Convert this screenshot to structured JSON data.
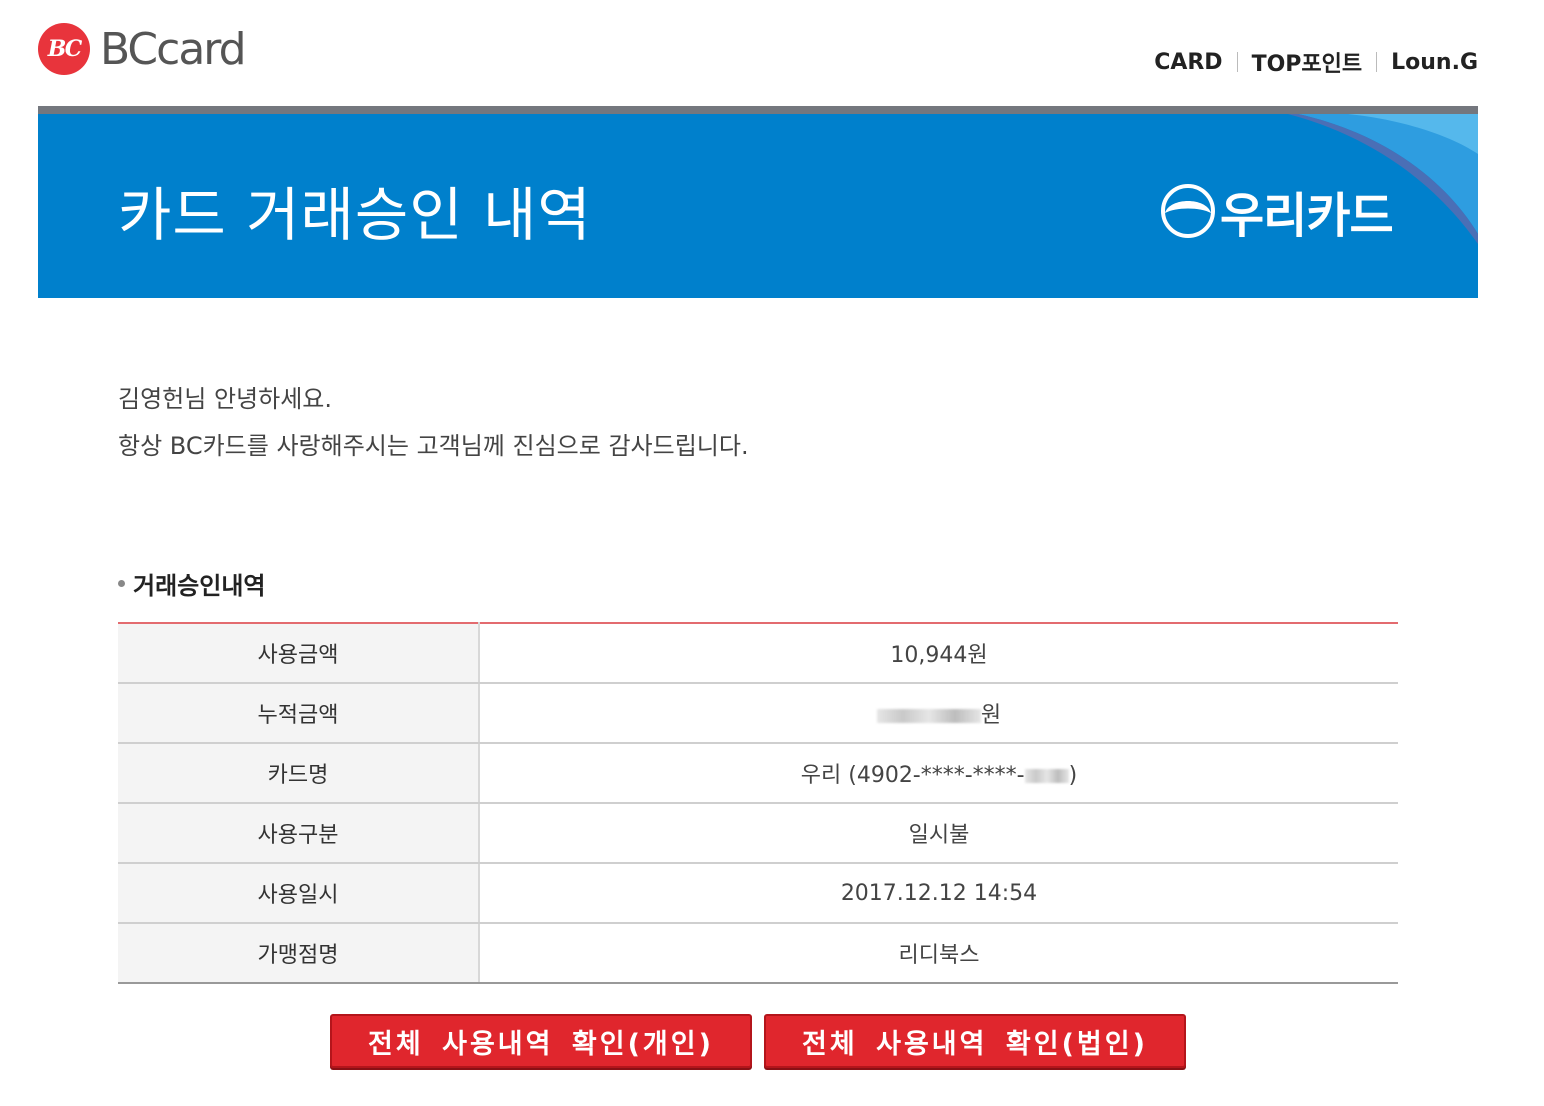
{
  "header": {
    "logo_mark": "BC",
    "logo_text": "BCcard",
    "nav": [
      "CARD",
      "TOP포인트",
      "Loun.G"
    ]
  },
  "banner": {
    "title": "카드 거래승인 내역",
    "issuer_logo_text": "우리카드"
  },
  "greeting": {
    "line1": "김영헌님 안녕하세요.",
    "line2": "항상 BC카드를 사랑해주시는 고객님께 진심으로 감사드립니다."
  },
  "section": {
    "title": "거래승인내역"
  },
  "details": {
    "amount_label": "사용금액",
    "amount_value": "10,944원",
    "cumulative_label": "누적금액",
    "cumulative_suffix": "원",
    "card_label": "카드명",
    "card_value_prefix": "우리 (4902-****-****-",
    "card_value_suffix": ")",
    "type_label": "사용구분",
    "type_value": "일시불",
    "datetime_label": "사용일시",
    "datetime_value": "2017.12.12 14:54",
    "merchant_label": "가맹점명",
    "merchant_value": "리디북스"
  },
  "buttons": {
    "personal": "전체 사용내역 확인(개인)",
    "corporate": "전체 사용내역 확인(법인)"
  },
  "colors": {
    "banner_blue": "#0080cc",
    "brand_red": "#e8343c",
    "button_red": "#e0262d"
  }
}
